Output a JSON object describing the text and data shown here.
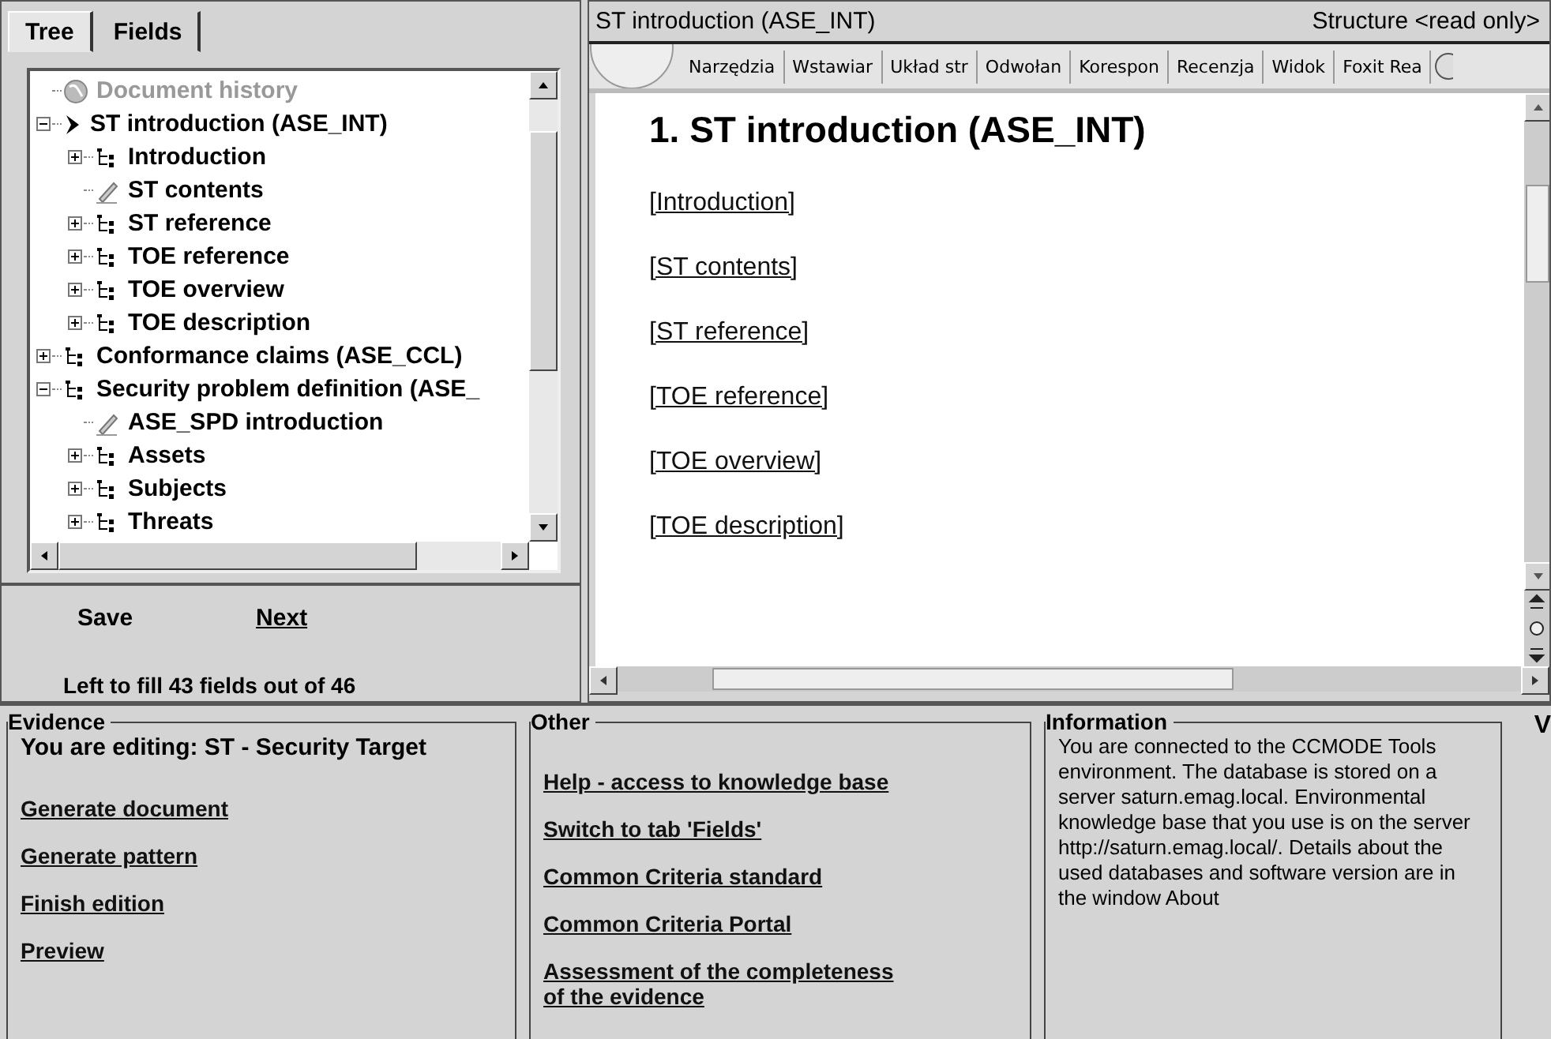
{
  "left_tabs": [
    {
      "label": "Tree",
      "selected": true
    },
    {
      "label": "Fields",
      "selected": false
    }
  ],
  "tree": {
    "items": [
      {
        "label": "Document history",
        "kind": "history",
        "disabled": true
      },
      {
        "label": "ST introduction (ASE_INT)",
        "kind": "chapter",
        "disabled": false,
        "expanded": true,
        "children": [
          {
            "label": "Introduction",
            "kind": "folder",
            "disabled": false,
            "expanded": false
          },
          {
            "label": "ST contents",
            "kind": "page",
            "disabled": false
          },
          {
            "label": "ST reference",
            "kind": "folder",
            "disabled": false,
            "expanded": false
          },
          {
            "label": "TOE reference",
            "kind": "folder",
            "disabled": false,
            "expanded": false
          },
          {
            "label": "TOE overview",
            "kind": "folder",
            "disabled": false,
            "expanded": false
          },
          {
            "label": "TOE description",
            "kind": "folder",
            "disabled": false,
            "expanded": false
          }
        ]
      },
      {
        "label": "Conformance claims (ASE_CCL)",
        "kind": "folder",
        "disabled": false,
        "expanded": false
      },
      {
        "label": "Security problem definition (ASE_",
        "kind": "folder",
        "disabled": false,
        "expanded": true,
        "children": [
          {
            "label": "ASE_SPD introduction",
            "kind": "page",
            "disabled": false
          },
          {
            "label": "Assets",
            "kind": "folder",
            "disabled": false,
            "expanded": false
          },
          {
            "label": "Subjects",
            "kind": "folder",
            "disabled": false,
            "expanded": false
          },
          {
            "label": "Threats",
            "kind": "folder",
            "disabled": false,
            "expanded": false
          }
        ]
      }
    ]
  },
  "buttons": [
    {
      "label": "Save",
      "underlined": false
    },
    {
      "label": "Next",
      "underlined": true
    }
  ],
  "fill_status": "Left to fill 43 fields out of 46",
  "document": {
    "title": "ST introduction (ASE_INT)",
    "mode": "Structure <read only>",
    "ribbon_tabs": [
      "Narzędzia",
      "Wstawiar",
      "Układ str",
      "Odwołan",
      "Korespon",
      "Recenzja",
      "Widok",
      "Foxit Rea"
    ],
    "heading": "1.  ST introduction  (ASE_INT)",
    "links": [
      "[Introduction]",
      "[ST contents]",
      "[ST reference]",
      "[TOE reference]",
      "[TOE overview]",
      "[TOE description]"
    ]
  },
  "evidence": {
    "title": "Evidence",
    "editing": "You are editing: ST - Security Target",
    "links": [
      "Generate document",
      "Generate pattern",
      "Finish edition",
      "Preview"
    ]
  },
  "other": {
    "title": "Other",
    "links": [
      "Help - access to knowledge base",
      "Switch to tab 'Fields'",
      "Common Criteria standard",
      "Common Criteria Portal",
      "Assessment of the completeness of the evidence"
    ]
  },
  "information": {
    "title": "Information",
    "text": "You are connected to the CCMODE Tools environment. The database is stored on a server saturn.emag.local. Environmental knowledge base that you use is on the server http://saturn.emag.local/. Details about the used databases and software version are in the window About"
  },
  "edge_text": "V"
}
